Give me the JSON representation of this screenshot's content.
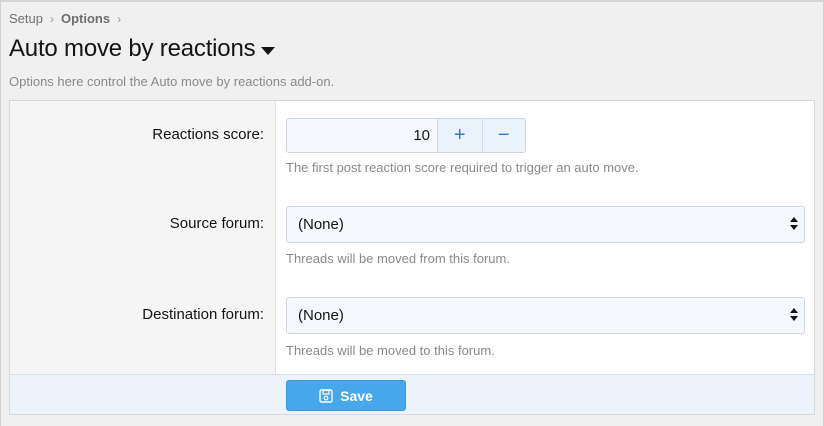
{
  "breadcrumb": {
    "items": [
      "Setup",
      "Options"
    ]
  },
  "page": {
    "title": "Auto move by reactions",
    "description": "Options here control the Auto move by reactions add-on."
  },
  "fields": {
    "reactions_score": {
      "label": "Reactions score:",
      "value": "10",
      "hint": "The first post reaction score required to trigger an auto move.",
      "plus": "+",
      "minus": "−"
    },
    "source_forum": {
      "label": "Source forum:",
      "value": "(None)",
      "hint": "Threads will be moved from this forum."
    },
    "destination_forum": {
      "label": "Destination forum:",
      "value": "(None)",
      "hint": "Threads will be moved to this forum."
    }
  },
  "footer": {
    "save_label": "Save"
  },
  "colors": {
    "accent": "#47a7eb",
    "input_bg": "#f5f8fc"
  }
}
